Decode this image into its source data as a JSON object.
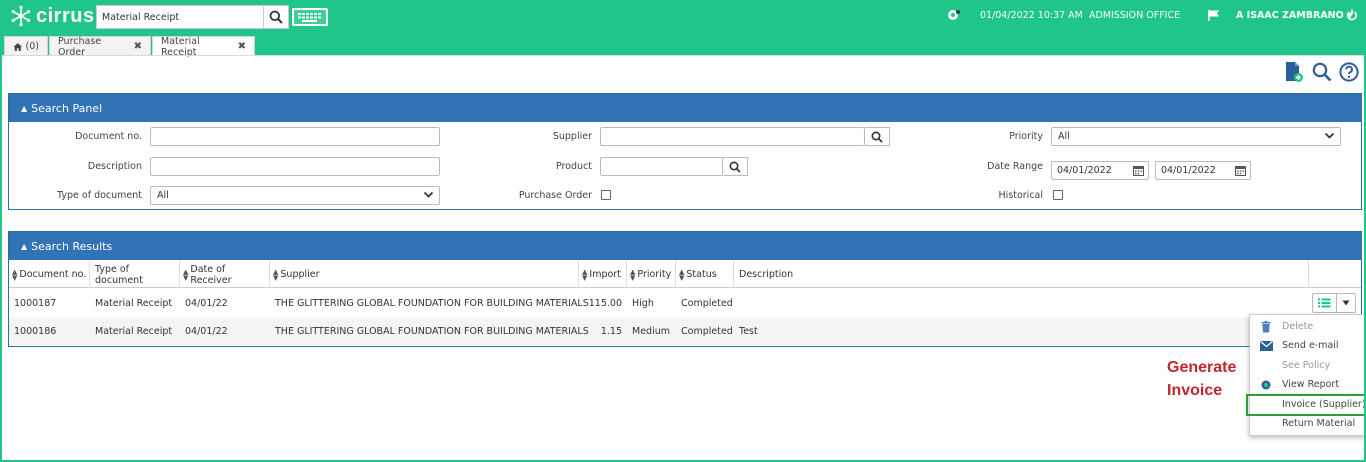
{
  "app": {
    "name": "cirrus",
    "brand_color": "#1fc688",
    "panel_color": "#3273b5"
  },
  "topbar": {
    "search_value": "Material Receipt",
    "datetime": "01/04/2022 10:37 AM",
    "office": "ADMISSION OFFICE",
    "user": "A ISAAC ZAMBRANO"
  },
  "tabs": [
    {
      "label": "(0)",
      "icon": "home-icon"
    },
    {
      "label": "Purchase Order"
    },
    {
      "label": "Material Receipt",
      "active": true
    }
  ],
  "search_panel": {
    "title": "Search Panel",
    "document_no_label": "Document no.",
    "document_no_value": "",
    "description_label": "Description",
    "description_value": "",
    "type_label": "Type of document",
    "type_value": "All",
    "supplier_label": "Supplier",
    "supplier_value": "",
    "product_label": "Product",
    "product_value": "",
    "purchase_order_label": "Purchase Order",
    "priority_label": "Priority",
    "priority_value": "All",
    "date_range_label": "Date Range",
    "date_from": "04/01/2022",
    "date_to": "04/01/2022",
    "historical_label": "Historical"
  },
  "results_panel": {
    "title": "Search Results",
    "columns": [
      "Document no.",
      "Type of document",
      "Date of Receiver",
      "Supplier",
      "Import",
      "Priority",
      "Status",
      "Description"
    ],
    "rows": [
      {
        "doc": "1000187",
        "type": "Material Receipt",
        "date": "04/01/22",
        "supplier": "THE GLITTERING GLOBAL FOUNDATION FOR BUILDING MATERIALS",
        "import": "115.00",
        "priority": "High",
        "status": "Completed",
        "description": ""
      },
      {
        "doc": "1000186",
        "type": "Material Receipt",
        "date": "04/01/22",
        "supplier": "THE GLITTERING GLOBAL FOUNDATION FOR BUILDING MATERIALS",
        "import": "1.15",
        "priority": "Medium",
        "status": "Completed",
        "description": "Test"
      }
    ]
  },
  "action_menu": {
    "items": [
      {
        "label": "Delete",
        "icon": "trash-icon"
      },
      {
        "label": "Send e-mail",
        "icon": "envelope-icon"
      },
      {
        "label": "See Policy",
        "icon": ""
      },
      {
        "label": "View Report",
        "icon": "report-icon"
      },
      {
        "label": "Invoice (Supplier)",
        "icon": ""
      },
      {
        "label": "Return Material",
        "icon": ""
      }
    ]
  },
  "annotation": {
    "line1": "Generate",
    "line2": "Invoice",
    "color": "#c0282d"
  }
}
